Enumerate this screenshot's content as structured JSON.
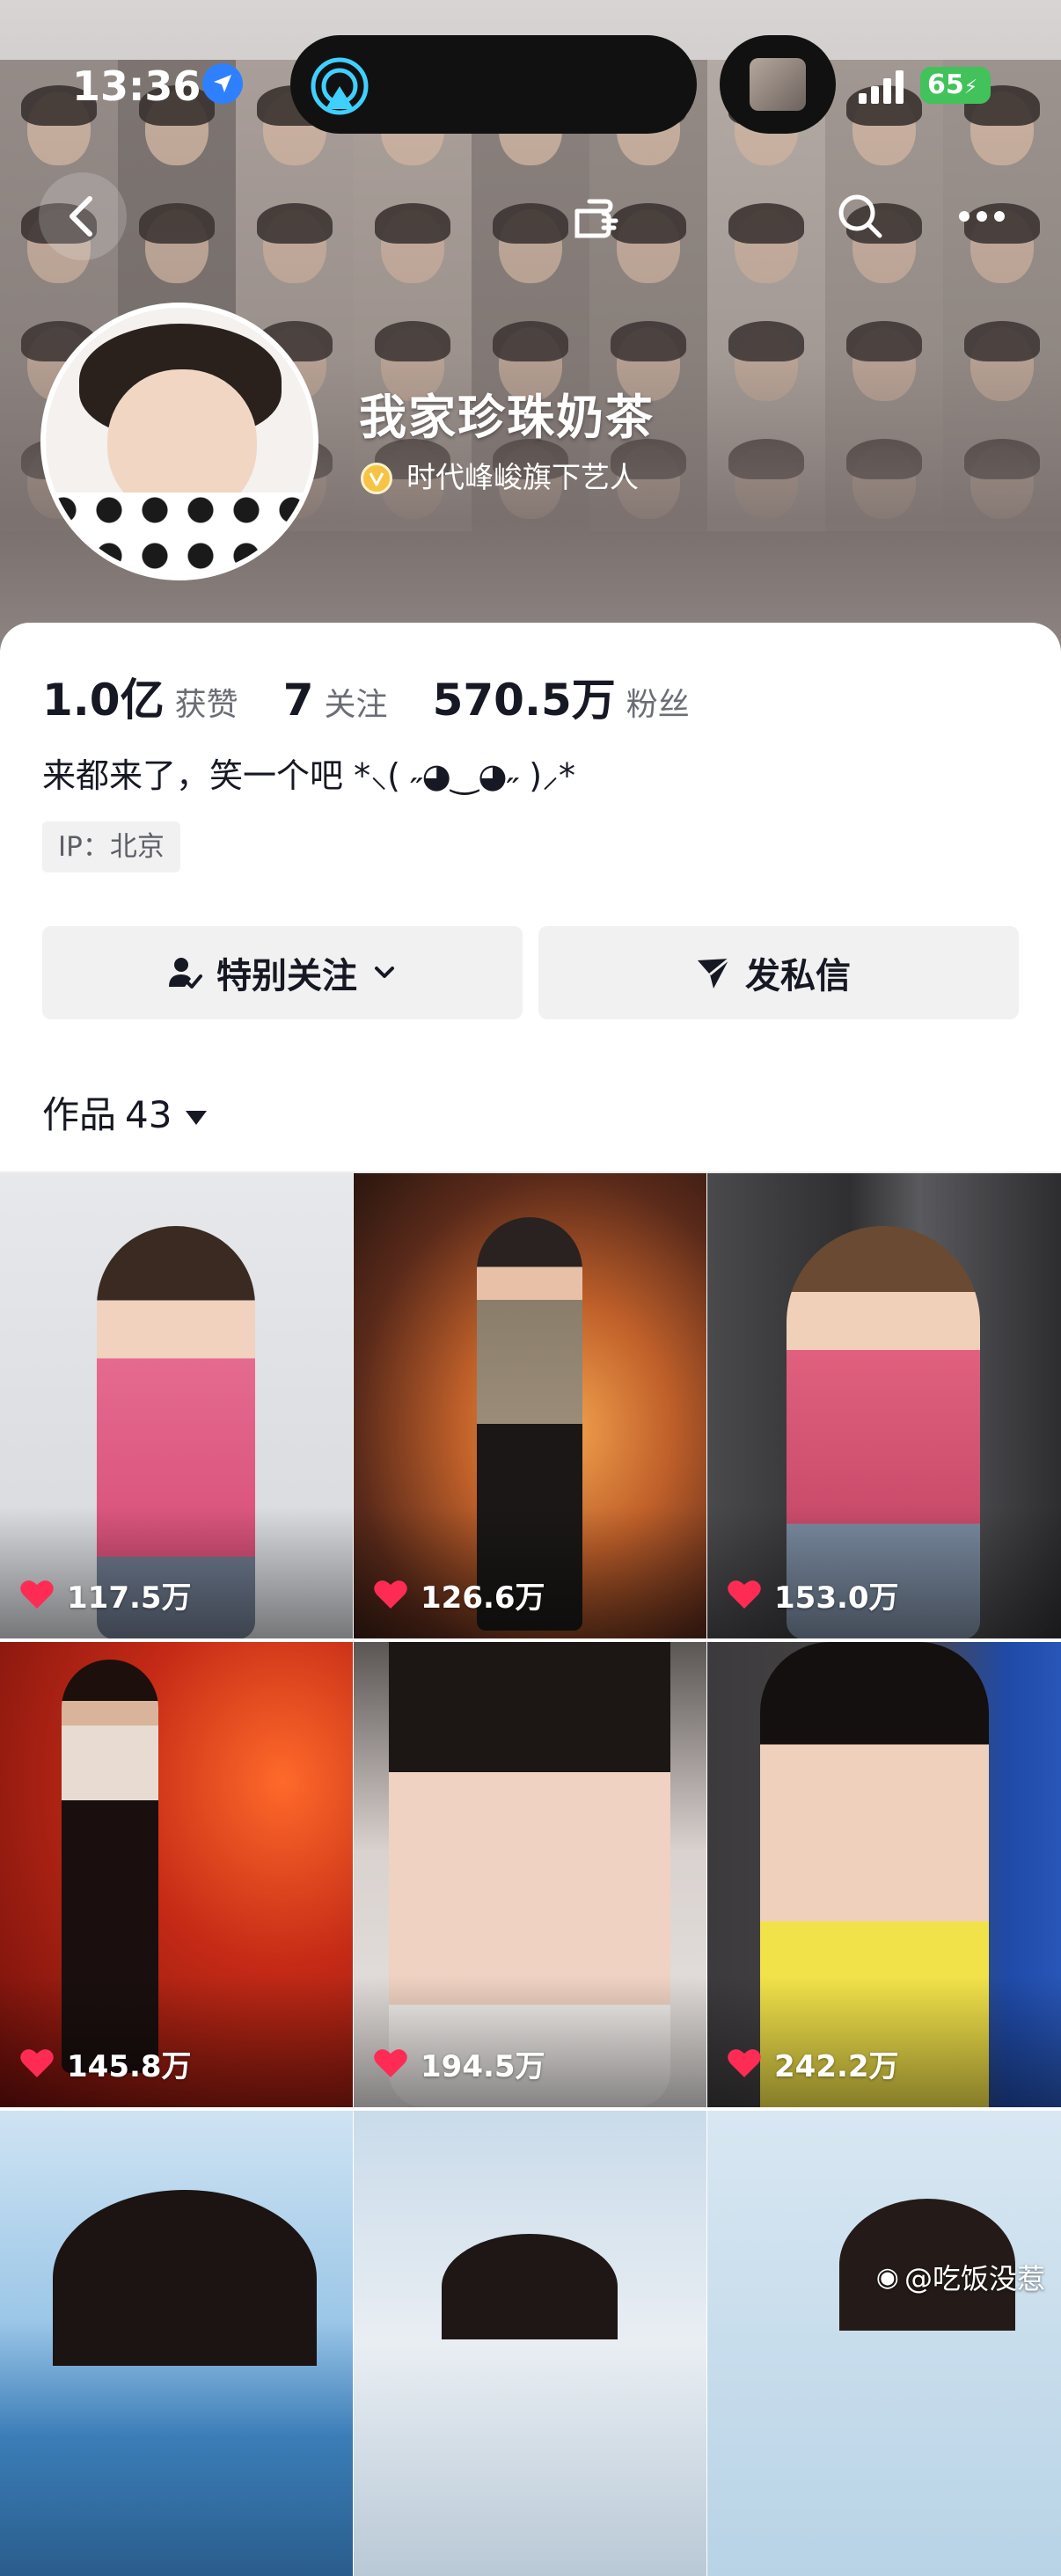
{
  "status_bar": {
    "time": "13:36",
    "battery": "65",
    "icons": [
      "location-arrow-icon",
      "airdrop-icon",
      "signal-bars-icon",
      "battery-charging-icon"
    ]
  },
  "nav": {
    "icons": [
      "back-icon",
      "pointing-hand-icon",
      "search-icon",
      "more-icon"
    ]
  },
  "profile": {
    "nickname": "我家珍珠奶茶",
    "verification": "时代峰峻旗下艺人",
    "verify_color": "#f6c344",
    "stats": [
      {
        "value": "1.0亿",
        "label": "获赞"
      },
      {
        "value": "7",
        "label": "关注"
      },
      {
        "value": "570.5万",
        "label": "粉丝"
      }
    ],
    "bio": "来都来了，笑一个吧 *⸜( ˶◕‿◕˶ )⸝*",
    "ip": "IP：北京"
  },
  "actions": {
    "follow_label": "特别关注",
    "message_label": "发私信"
  },
  "works": {
    "label": "作品",
    "count": "43"
  },
  "videos": [
    {
      "likes": "117.5万"
    },
    {
      "likes": "126.6万"
    },
    {
      "likes": "153.0万"
    },
    {
      "likes": "145.8万"
    },
    {
      "likes": "194.5万"
    },
    {
      "likes": "242.2万"
    },
    {
      "likes": ""
    },
    {
      "likes": ""
    },
    {
      "likes": ""
    }
  ],
  "watermark": "@吃饭没惹",
  "colors": {
    "text_primary": "#161823",
    "heart": "#fe2c55",
    "location_blue": "#2f80ff",
    "battery_green": "#41c25a"
  }
}
